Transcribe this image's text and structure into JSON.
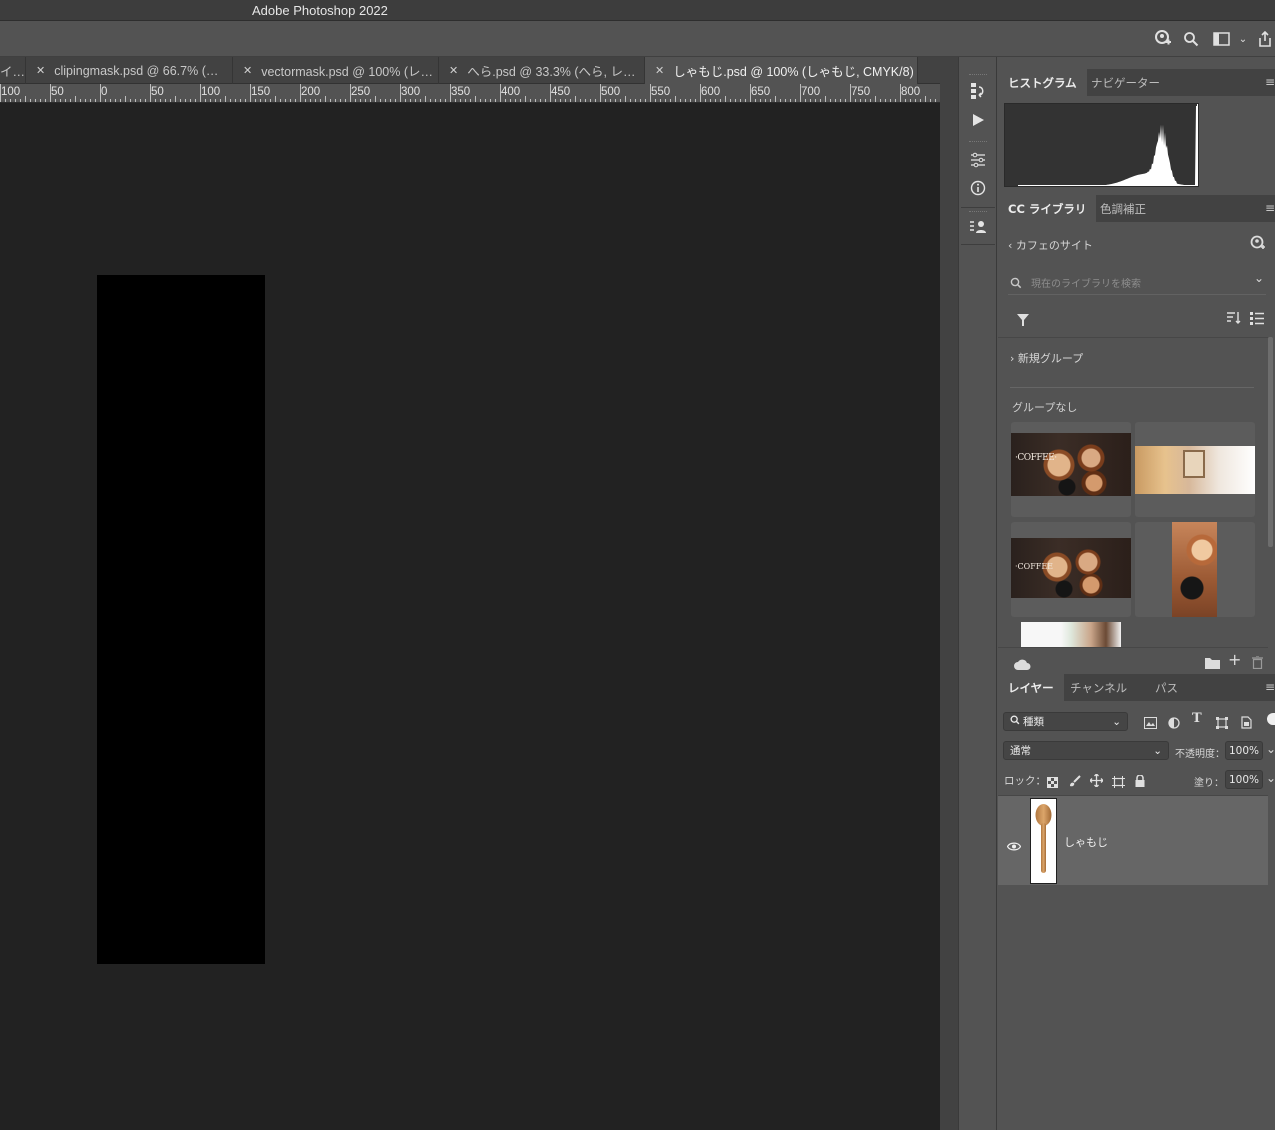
{
  "app": {
    "title": "Adobe Photoshop 2022"
  },
  "topbar": {
    "icons": [
      "user-plus-icon",
      "search-icon",
      "workspace-icon",
      "chevron-down-icon",
      "share-icon"
    ]
  },
  "tabs": [
    {
      "label": "イ…",
      "active": false
    },
    {
      "label": "clipingmask.psd @ 66.7% (…",
      "active": false
    },
    {
      "label": "vectormask.psd @ 100% (レ…",
      "active": false
    },
    {
      "label": "へら.psd @ 33.3% (へら, レ…",
      "active": false
    },
    {
      "label": "しゃもじ.psd @ 100% (しゃもじ, CMYK/8)",
      "active": true
    }
  ],
  "ruler": {
    "labels": [
      "100",
      "50",
      "0",
      "50",
      "100",
      "150",
      "200",
      "250",
      "300",
      "350",
      "400",
      "450",
      "500",
      "550",
      "600",
      "650",
      "700",
      "750",
      "800"
    ]
  },
  "strip": {
    "icons": [
      "history-icon",
      "play-actions-icon",
      "adjustments-icon",
      "info-icon",
      "properties-icon"
    ]
  },
  "panels": {
    "histogram_tabs": [
      "ヒストグラム",
      "ナビゲーター"
    ],
    "library_tabs": [
      "CC ライブラリ",
      "色調補正"
    ],
    "library": {
      "back_label": "カフェのサイト",
      "search_placeholder": "現在のライブラリを検索",
      "group_label": "新規グループ",
      "no_group_label": "グループなし",
      "thumbnails": [
        "coffee-cups-photo",
        "interior-photo",
        "coffee-cups-photo-2",
        "coffee-vertical-photo",
        "plants-photo"
      ]
    },
    "layer_tabs": [
      "レイヤー",
      "チャンネル",
      "パス"
    ],
    "layers": {
      "filter_kind": "種類",
      "blend_mode": "通常",
      "opacity_label": "不透明度：",
      "opacity_value": "100%",
      "lock_label": "ロック：",
      "fill_label": "塗り：",
      "fill_value": "100%",
      "items": [
        {
          "name": "しゃもじ",
          "visible": true
        }
      ]
    }
  },
  "colors": {
    "canvas": "#222222",
    "panel": "#535353",
    "accent": "#ffffff"
  }
}
